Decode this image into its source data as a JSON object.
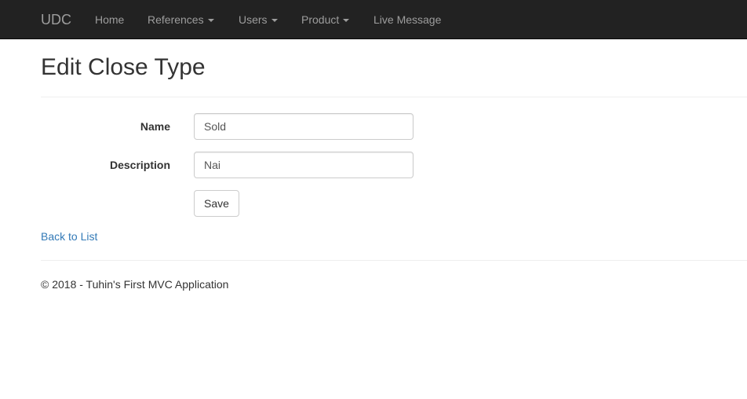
{
  "navbar": {
    "brand": "UDC",
    "items": [
      {
        "label": "Home",
        "dropdown": false
      },
      {
        "label": "References",
        "dropdown": true
      },
      {
        "label": "Users",
        "dropdown": true
      },
      {
        "label": "Product",
        "dropdown": true
      },
      {
        "label": "Live Message",
        "dropdown": false
      }
    ]
  },
  "page": {
    "title": "Edit Close Type"
  },
  "form": {
    "name_label": "Name",
    "name_value": "Sold",
    "description_label": "Description",
    "description_value": "Nai",
    "save_label": "Save"
  },
  "links": {
    "back_to_list": "Back to List"
  },
  "footer": {
    "text": "© 2018 - Tuhin's First MVC Application"
  },
  "colors": {
    "navbar_bg": "#222222",
    "navbar_text": "#9d9d9d",
    "link": "#337ab7"
  }
}
